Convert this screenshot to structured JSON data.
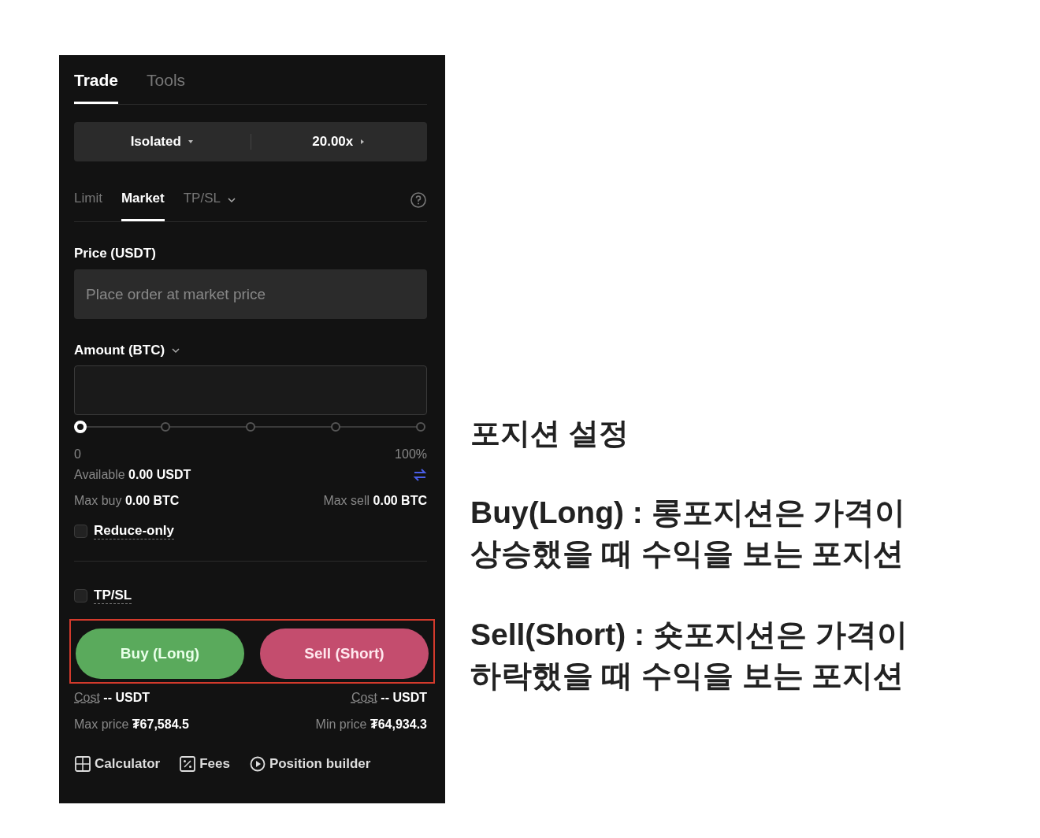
{
  "panel": {
    "tabs": [
      {
        "label": "Trade",
        "selected": true
      },
      {
        "label": "Tools",
        "selected": false
      }
    ],
    "margin_mode": "Isolated",
    "leverage": "20.00x",
    "order_types": [
      {
        "label": "Limit",
        "selected": false,
        "dropdown": false
      },
      {
        "label": "Market",
        "selected": true,
        "dropdown": false
      },
      {
        "label": "TP/SL",
        "selected": false,
        "dropdown": true
      }
    ],
    "price": {
      "label": "Price (USDT)",
      "placeholder": "Place order at market price"
    },
    "amount": {
      "label": "Amount (BTC)"
    },
    "slider": {
      "level": 0,
      "min_label": "0",
      "max_label": "100%"
    },
    "available": {
      "label": "Available",
      "value": "0.00 USDT"
    },
    "max_buy": {
      "label": "Max buy",
      "value": "0.00 BTC"
    },
    "max_sell": {
      "label": "Max sell",
      "value": "0.00 BTC"
    },
    "checkboxes": [
      {
        "label": "Reduce-only",
        "checked": false,
        "divider_after": true
      },
      {
        "label": "TP/SL",
        "checked": false,
        "divider_after": false
      }
    ],
    "actions": [
      {
        "label": "Buy (Long)",
        "kind": "buy",
        "cost_label": "Cost",
        "cost_value": "-- USDT",
        "price_label": "Max price",
        "price_value": "₮67,584.5"
      },
      {
        "label": "Sell (Short)",
        "kind": "sell",
        "cost_label": "Cost",
        "cost_value": "-- USDT",
        "price_label": "Min price",
        "price_value": "₮64,934.3"
      }
    ],
    "links": [
      {
        "label": "Calculator",
        "kind": "calculator"
      },
      {
        "label": "Fees",
        "kind": "fees"
      },
      {
        "label": "Position builder",
        "kind": "builder"
      }
    ]
  },
  "annotation": {
    "title": "포지션 설정",
    "paragraphs": [
      {
        "lines": [
          "Buy(Long) : 롱포지션은 가격이",
          "상승했을 때 수익을 보는 포지션"
        ]
      },
      {
        "lines": [
          "Sell(Short) : 숏포지션은 가격이",
          "하락했을 때 수익을 보는 포지션"
        ]
      }
    ]
  }
}
